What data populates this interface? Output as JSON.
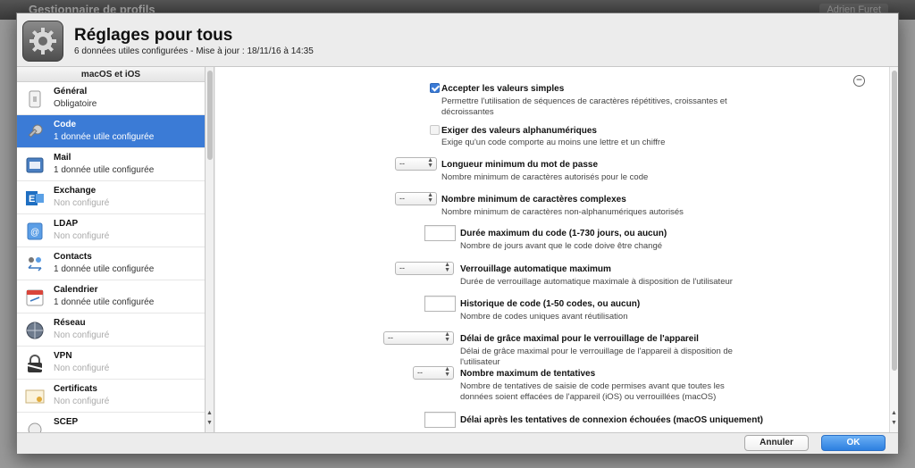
{
  "background": {
    "title": "Gestionnaire de profils",
    "user": "Adrien Furet"
  },
  "header": {
    "title": "Réglages pour tous",
    "subtitle": "6 données utiles configurées - Mise à jour : 18/11/16 à 14:35"
  },
  "sidebar": {
    "section": "macOS et iOS",
    "items": [
      {
        "name": "Général",
        "sub": "Obligatoire",
        "icon": "general-icon",
        "dim": false
      },
      {
        "name": "Code",
        "sub": "1 donnée utile configurée",
        "icon": "key-icon",
        "dim": false,
        "selected": true
      },
      {
        "name": "Mail",
        "sub": "1 donnée utile configurée",
        "icon": "mail-icon",
        "dim": false
      },
      {
        "name": "Exchange",
        "sub": "Non configuré",
        "icon": "exchange-icon",
        "dim": true
      },
      {
        "name": "LDAP",
        "sub": "Non configuré",
        "icon": "ldap-icon",
        "dim": true
      },
      {
        "name": "Contacts",
        "sub": "1 donnée utile configurée",
        "icon": "contacts-icon",
        "dim": false
      },
      {
        "name": "Calendrier",
        "sub": "1 donnée utile configurée",
        "icon": "calendar-icon",
        "dim": false
      },
      {
        "name": "Réseau",
        "sub": "Non configuré",
        "icon": "network-icon",
        "dim": true
      },
      {
        "name": "VPN",
        "sub": "Non configuré",
        "icon": "vpn-icon",
        "dim": true
      },
      {
        "name": "Certificats",
        "sub": "Non configuré",
        "icon": "certificate-icon",
        "dim": true
      },
      {
        "name": "SCEP",
        "sub": "",
        "icon": "scep-icon",
        "dim": true
      }
    ]
  },
  "settings": {
    "simple": {
      "label": "Accepter les valeurs simples",
      "desc": "Permettre l'utilisation de séquences de caractères répétitives, croissantes et décroissantes",
      "checked": true
    },
    "alnum": {
      "label": "Exiger des valeurs alphanumériques",
      "desc": "Exige qu'un code comporte au moins une lettre et un chiffre",
      "checked": false
    },
    "minlen": {
      "label": "Longueur minimum du mot de passe",
      "desc": "Nombre minimum de caractères autorisés pour le code",
      "value": "--"
    },
    "complex": {
      "label": "Nombre minimum de caractères complexes",
      "desc": "Nombre minimum de caractères non-alphanumériques autorisés",
      "value": "--"
    },
    "maxage": {
      "label": "Durée maximum du code (1-730 jours, ou aucun)",
      "desc": "Nombre de jours avant que le code doive être changé"
    },
    "autolock": {
      "label": "Verrouillage automatique maximum",
      "desc": "Durée de verrouillage automatique maximale à disposition de l'utilisateur",
      "value": "--"
    },
    "history": {
      "label": "Historique de code (1-50 codes, ou aucun)",
      "desc": "Nombre de codes uniques avant réutilisation"
    },
    "grace": {
      "label": "Délai de grâce maximal pour le verrouillage de l'appareil",
      "desc": "Délai de grâce maximal pour le verrouillage de l'appareil à disposition de l'utilisateur",
      "value": "--"
    },
    "attempts": {
      "label": "Nombre maximum de tentatives",
      "desc": "Nombre de tentatives de saisie de code permises avant que toutes les données soient effacées de l'appareil (iOS) ou verrouillées (macOS)",
      "value": "--"
    },
    "delay": {
      "label": "Délai après les tentatives de connexion échouées (macOS uniquement)"
    }
  },
  "footer": {
    "cancel": "Annuler",
    "ok": "OK"
  },
  "colors": {
    "accent": "#3b7bd6"
  }
}
